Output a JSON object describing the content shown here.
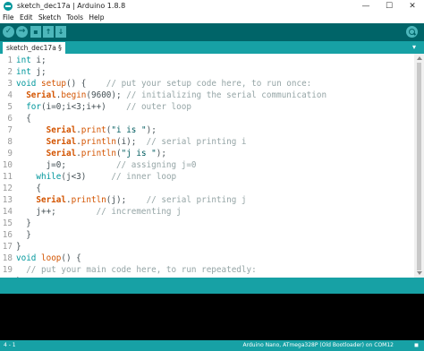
{
  "window": {
    "title": "sketch_dec17a | Arduino 1.8.8",
    "minimize": "—",
    "maximize": "☐",
    "close": "✕"
  },
  "menubar": {
    "items": [
      "File",
      "Edit",
      "Sketch",
      "Tools",
      "Help"
    ]
  },
  "toolbar": {
    "verify_icon": "✓",
    "upload_icon": "→",
    "new_icon": "▪",
    "open_icon": "↑",
    "save_icon": "↓"
  },
  "tab": {
    "label": "sketch_dec17a §",
    "menu_icon": "▾"
  },
  "editor": {
    "lines": [
      {
        "num": "1",
        "code": "int i;"
      },
      {
        "num": "2",
        "code": "int j;"
      },
      {
        "num": "3",
        "code": "void setup() {    // put your setup code here, to run once:"
      },
      {
        "num": "4",
        "code": "  Serial.begin(9600); // initializing the serial communication"
      },
      {
        "num": "5",
        "code": "  for(i=0;i<3;i++)    // outer loop"
      },
      {
        "num": "6",
        "code": "  {"
      },
      {
        "num": "7",
        "code": "      Serial.print(\"i is \");"
      },
      {
        "num": "8",
        "code": "      Serial.println(i);  // serial printing i"
      },
      {
        "num": "9",
        "code": "      Serial.println(\"j is \");"
      },
      {
        "num": "10",
        "code": "      j=0;          // assigning j=0"
      },
      {
        "num": "11",
        "code": "    while(j<3)     // inner loop"
      },
      {
        "num": "12",
        "code": "    {"
      },
      {
        "num": "13",
        "code": "    Serial.println(j);    // serial printing j"
      },
      {
        "num": "14",
        "code": "    j++;        // incrementing j"
      },
      {
        "num": "15",
        "code": "  }"
      },
      {
        "num": "16",
        "code": "  }"
      },
      {
        "num": "17",
        "code": "}"
      },
      {
        "num": "18",
        "code": "void loop() {"
      },
      {
        "num": "19",
        "code": "  // put your main code here, to run repeatedly:"
      },
      {
        "num": "20",
        "code": "}"
      }
    ]
  },
  "status": {
    "line": "4 - 1",
    "board": "Arduino Nano, ATmega328P (Old Bootloader) on COM12"
  },
  "colors": {
    "toolbar": "#006468",
    "accent": "#17a1a5",
    "keyword": "#00979c",
    "function": "#d35400",
    "comment": "#95a5a6"
  }
}
